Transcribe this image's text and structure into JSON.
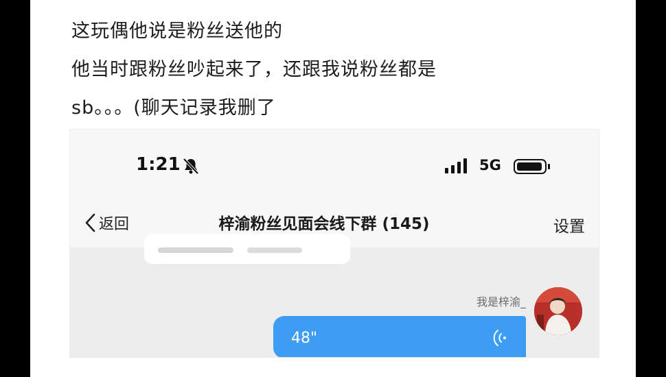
{
  "post": {
    "lines": [
      "这玩偶他说是粉丝送他的",
      "他当时跟粉丝吵起来了，还跟我说粉丝都是",
      "sb。。。(聊天记录我删了"
    ]
  },
  "status_bar": {
    "time": "1:21",
    "network": "5G",
    "icons": [
      "bell-slash-icon",
      "signal-bars-icon",
      "battery-icon"
    ]
  },
  "nav": {
    "back_label": "返回",
    "title": "梓渝粉丝见面会线下群 (145)",
    "settings_label": "设置"
  },
  "chat": {
    "message": {
      "sender": "我是梓渝_",
      "voice_duration": "48\"",
      "bubble_color": "#3d9df2"
    }
  }
}
